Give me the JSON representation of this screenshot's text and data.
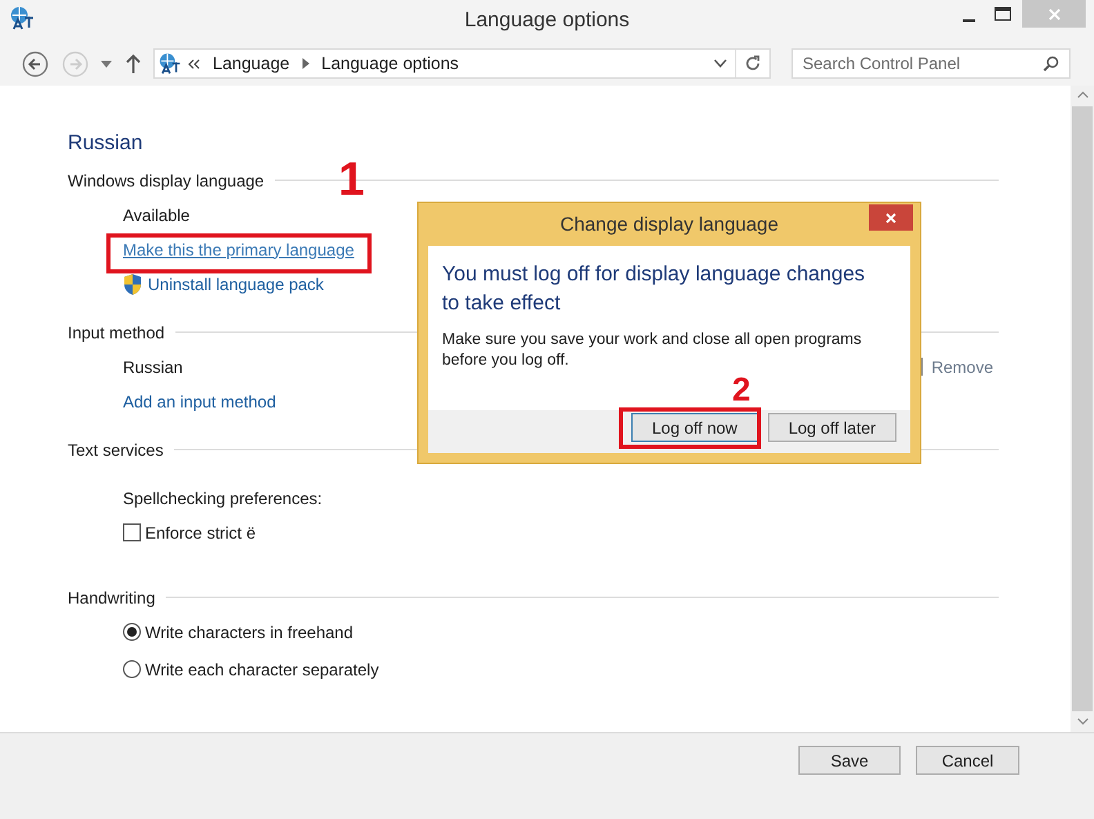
{
  "window": {
    "title": "Language options"
  },
  "nav": {
    "breadcrumb": [
      "Language",
      "Language options"
    ],
    "search_placeholder": "Search Control Panel"
  },
  "page": {
    "heading": "Russian",
    "sections": [
      {
        "title": "Windows display language",
        "items": [
          {
            "kind": "text",
            "text": "Available"
          },
          {
            "kind": "link",
            "text": "Make this the primary language",
            "highlighted": true,
            "annotation": "1"
          },
          {
            "kind": "shield-link",
            "text": "Uninstall language pack"
          }
        ]
      },
      {
        "title": "Input method",
        "items": [
          {
            "kind": "method",
            "text": "Russian",
            "action": "Remove"
          },
          {
            "kind": "link",
            "text": "Add an input method",
            "highlighted": false
          }
        ]
      },
      {
        "title": "Text services",
        "items": [
          {
            "kind": "subheading",
            "text": "Spellchecking preferences:"
          },
          {
            "kind": "checkbox",
            "text": "Enforce strict ë",
            "checked": false
          }
        ]
      },
      {
        "title": "Handwriting",
        "items": [
          {
            "kind": "radio",
            "text": "Write characters in freehand",
            "selected": true
          },
          {
            "kind": "radio",
            "text": "Write each character separately",
            "selected": false
          }
        ]
      }
    ]
  },
  "footer": {
    "buttons": [
      "Save",
      "Cancel"
    ]
  },
  "dialog": {
    "title": "Change display language",
    "heading": "You must log off for display language changes to take effect",
    "message": "Make sure you save your work and close all open programs before you log off.",
    "buttons": [
      {
        "label": "Log off now",
        "highlighted": true,
        "annotation": "2"
      },
      {
        "label": "Log off later",
        "highlighted": false
      }
    ]
  }
}
